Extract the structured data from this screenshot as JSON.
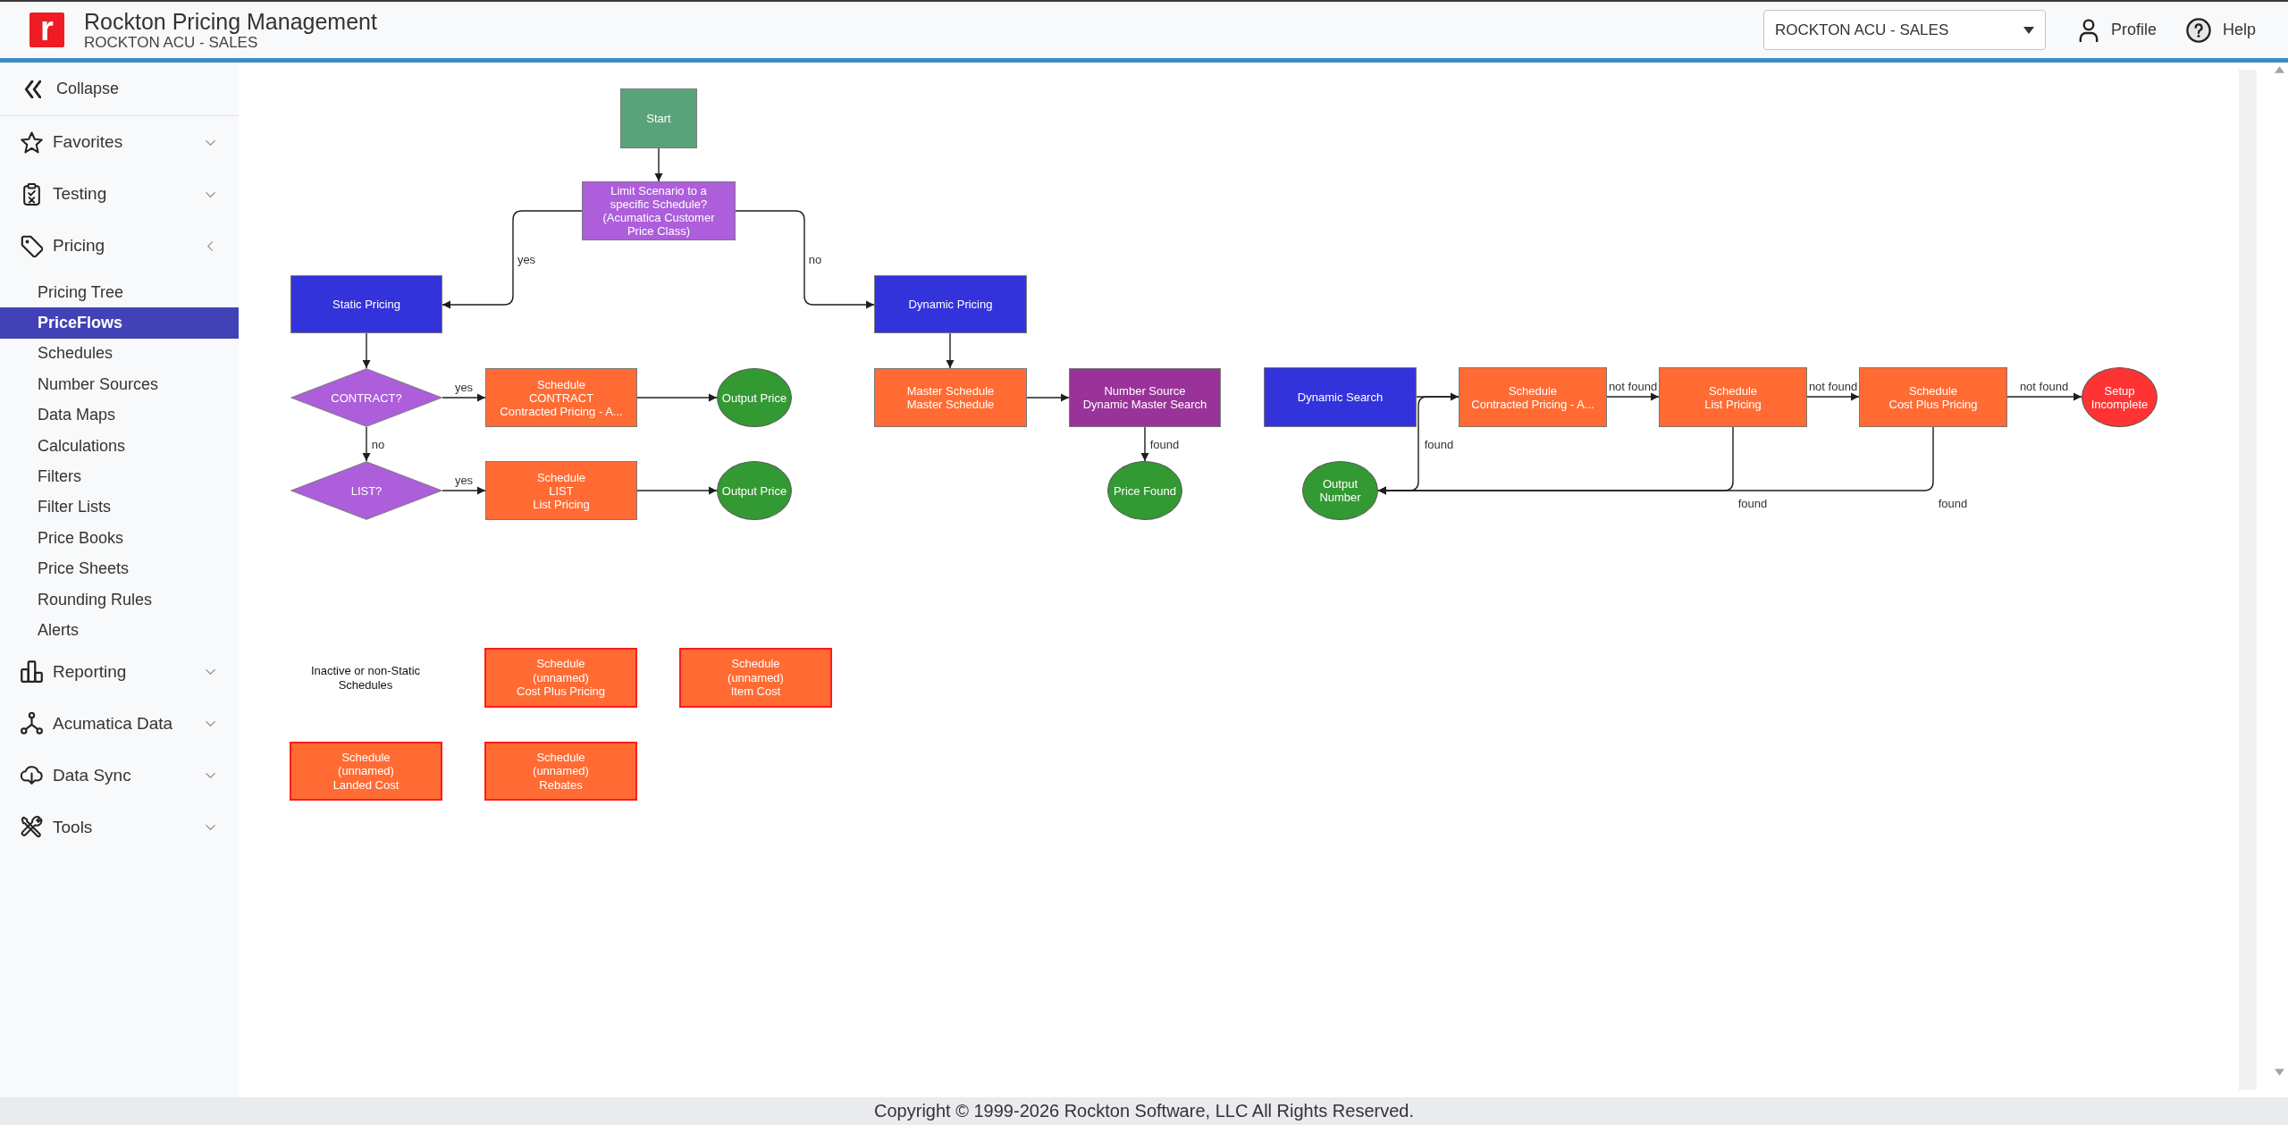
{
  "header": {
    "logo_mark": "r",
    "app_title": "Rockton Pricing Management",
    "company": "ROCKTON ACU - SALES",
    "company_select": {
      "value": "ROCKTON ACU - SALES"
    },
    "profile_link": "Profile",
    "help_link": "Help"
  },
  "sidebar": {
    "collapse": "Collapse",
    "groups": [
      {
        "label": "Favorites",
        "expanded": false
      },
      {
        "label": "Testing",
        "expanded": false
      },
      {
        "label": "Pricing",
        "expanded": true,
        "children": [
          {
            "label": "Pricing Tree",
            "selected": false
          },
          {
            "label": "PriceFlows",
            "selected": true
          },
          {
            "label": "Schedules",
            "selected": false
          },
          {
            "label": "Number Sources",
            "selected": false
          },
          {
            "label": "Data Maps",
            "selected": false
          },
          {
            "label": "Calculations",
            "selected": false
          },
          {
            "label": "Filters",
            "selected": false
          },
          {
            "label": "Filter Lists",
            "selected": false
          },
          {
            "label": "Price Books",
            "selected": false
          },
          {
            "label": "Price Sheets",
            "selected": false
          },
          {
            "label": "Rounding Rules",
            "selected": false
          },
          {
            "label": "Alerts",
            "selected": false
          }
        ]
      },
      {
        "label": "Reporting",
        "expanded": false
      },
      {
        "label": "Acumatica Data",
        "expanded": false
      },
      {
        "label": "Data Sync",
        "expanded": false
      },
      {
        "label": "Tools",
        "expanded": false
      }
    ]
  },
  "flow": {
    "nodes": [
      {
        "kind": "rect",
        "label": "Start",
        "color": "#58a37a"
      },
      {
        "kind": "rect",
        "label": "Limit Scenario to a\nspecific Schedule?\n(Acumatica Customer\nPrice Class)",
        "color": "#ad5edb"
      },
      {
        "kind": "rect",
        "label": "Static Pricing",
        "color": "#3333dc"
      },
      {
        "kind": "rect",
        "label": "Dynamic Pricing",
        "color": "#3333dc"
      },
      {
        "kind": "diamond",
        "label": "CONTRACT?",
        "color": "#ad5edb"
      },
      {
        "kind": "rect",
        "label": "Schedule\nCONTRACT\nContracted Pricing - A...",
        "color": "#ff6b33"
      },
      {
        "kind": "ellipse",
        "label": "Output Price",
        "color": "#339933"
      },
      {
        "kind": "diamond",
        "label": "LIST?",
        "color": "#ad5edb"
      },
      {
        "kind": "rect",
        "label": "Schedule\nLIST\nList Pricing",
        "color": "#ff6b33"
      },
      {
        "kind": "ellipse",
        "label": "Output Price",
        "color": "#339933"
      },
      {
        "kind": "rect",
        "label": "Master Schedule\nMaster Schedule",
        "color": "#ff6b33"
      },
      {
        "kind": "rect",
        "label": "Number Source\nDynamic Master Search",
        "color": "#993399"
      },
      {
        "kind": "ellipse",
        "label": "Price Found",
        "color": "#339933"
      },
      {
        "kind": "rect",
        "label": "Dynamic Search",
        "color": "#3333dc"
      },
      {
        "kind": "rect",
        "label": "Schedule\nContracted Pricing - A...",
        "color": "#ff6b33"
      },
      {
        "kind": "rect",
        "label": "Schedule\nList Pricing",
        "color": "#ff6b33"
      },
      {
        "kind": "rect",
        "label": "Schedule\nCost Plus Pricing",
        "color": "#ff6b33"
      },
      {
        "kind": "ellipse",
        "label": "Setup\nIncomplete",
        "color": "#ff3333"
      },
      {
        "kind": "ellipse",
        "label": "Output\nNumber",
        "color": "#339933"
      }
    ],
    "edge_labels": [
      "yes",
      "no",
      "yes",
      "no",
      "yes",
      "found",
      "found",
      "not found",
      "not found",
      "not found",
      "found",
      "found"
    ],
    "inactive": {
      "caption": "Inactive or non-Static Schedules",
      "schedules": [
        {
          "label": "Schedule\n(unnamed)\nCost Plus Pricing"
        },
        {
          "label": "Schedule\n(unnamed)\nItem Cost"
        },
        {
          "label": "Schedule\n(unnamed)\nLanded Cost"
        },
        {
          "label": "Schedule\n(unnamed)\nRebates"
        }
      ]
    }
  },
  "footer": {
    "copyright": "Copyright © 1999-2026 Rockton Software, LLC All Rights Reserved."
  }
}
